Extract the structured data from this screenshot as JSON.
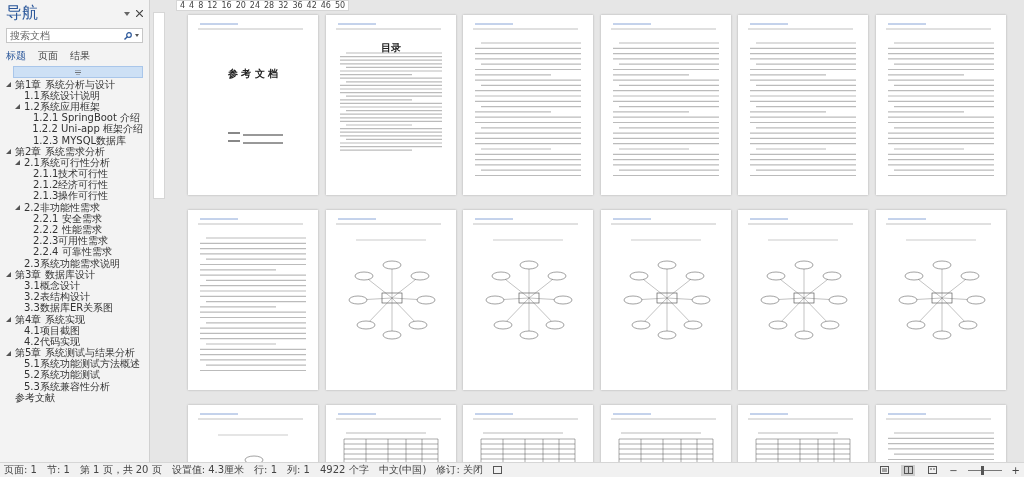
{
  "navigation": {
    "title": "导航",
    "search": {
      "placeholder": "搜索文档"
    },
    "tabs": [
      {
        "label": "标题",
        "selected": true
      },
      {
        "label": "页面",
        "selected": false
      },
      {
        "label": "结果",
        "selected": false
      }
    ],
    "tree": [
      {
        "kind": "untitled",
        "selected": true
      },
      {
        "text": "第1章 系统分析与设计",
        "selected": false,
        "expanded": true,
        "children": [
          {
            "text": "1.1系统设计说明",
            "selected": false
          },
          {
            "text": "1.2系统应用框架",
            "selected": false,
            "expanded": true,
            "children": [
              {
                "text": "1.2.1 SpringBoot 介绍",
                "selected": false
              },
              {
                "text": "1.2.2 Uni-app 框架介绍",
                "selected": false
              },
              {
                "text": "1.2.3 MYSQL数据库",
                "selected": false
              }
            ]
          }
        ]
      },
      {
        "text": "第2章 系统需求分析",
        "selected": false,
        "expanded": true,
        "children": [
          {
            "text": "2.1系统可行性分析",
            "selected": false,
            "expanded": true,
            "children": [
              {
                "text": "2.1.1技术可行性",
                "selected": false
              },
              {
                "text": "2.1.2经济可行性",
                "selected": false
              },
              {
                "text": "2.1.3操作可行性",
                "selected": false
              }
            ]
          },
          {
            "text": "2.2非功能性需求",
            "selected": false,
            "expanded": true,
            "children": [
              {
                "text": "2.2.1 安全需求",
                "selected": false
              },
              {
                "text": "2.2.2 性能需求",
                "selected": false
              },
              {
                "text": "2.2.3可用性需求",
                "selected": false
              },
              {
                "text": "2.2.4 可靠性需求",
                "selected": false
              }
            ]
          },
          {
            "text": "2.3系统功能需求说明",
            "selected": false
          }
        ]
      },
      {
        "text": "第3章 数据库设计",
        "selected": false,
        "expanded": true,
        "children": [
          {
            "text": "3.1概念设计",
            "selected": false
          },
          {
            "text": "3.2表结构设计",
            "selected": false
          },
          {
            "text": "3.3数据库ER关系图",
            "selected": false
          }
        ]
      },
      {
        "text": "第4章 系统实现",
        "selected": false,
        "expanded": true,
        "children": [
          {
            "text": "4.1项目截图",
            "selected": false
          },
          {
            "text": "4.2代码实现",
            "selected": false
          }
        ]
      },
      {
        "text": "第5章 系统测试与结果分析",
        "selected": false,
        "expanded": true,
        "children": [
          {
            "text": "5.1系统功能测试方法概述",
            "selected": false
          },
          {
            "text": "5.2系统功能测试",
            "selected": false
          },
          {
            "text": "5.3系统兼容性分析",
            "selected": false
          }
        ]
      },
      {
        "text": "参考文献",
        "selected": false
      }
    ]
  },
  "ruler": {
    "labels": [
      "4",
      "4",
      "8",
      "12",
      "16",
      "20",
      "24",
      "28",
      "32",
      "36",
      "42",
      "46",
      "50"
    ]
  },
  "pages": [
    {
      "kind": "cover",
      "title": "参 考 文 档"
    },
    {
      "kind": "toc",
      "title": "目录"
    },
    {
      "kind": "text"
    },
    {
      "kind": "text"
    },
    {
      "kind": "text"
    },
    {
      "kind": "text"
    },
    {
      "kind": "text"
    },
    {
      "kind": "er"
    },
    {
      "kind": "er"
    },
    {
      "kind": "er"
    },
    {
      "kind": "er"
    },
    {
      "kind": "er"
    },
    {
      "kind": "er"
    },
    {
      "kind": "table"
    },
    {
      "kind": "table"
    },
    {
      "kind": "table"
    },
    {
      "kind": "table"
    },
    {
      "kind": "text"
    }
  ],
  "status_bar": {
    "items": [
      "页面: 1",
      "节: 1",
      "第 1 页，共 20 页",
      "设置值: 4.3厘米",
      "行: 1",
      "列: 1",
      "4922 个字",
      "中文(中国)",
      "修订: 关闭"
    ],
    "views": [
      {
        "selected": false
      },
      {
        "selected": true
      },
      {
        "selected": false
      }
    ],
    "zoom": {
      "level": 0.45,
      "zoom_out": "−",
      "zoom_in": "+"
    }
  }
}
